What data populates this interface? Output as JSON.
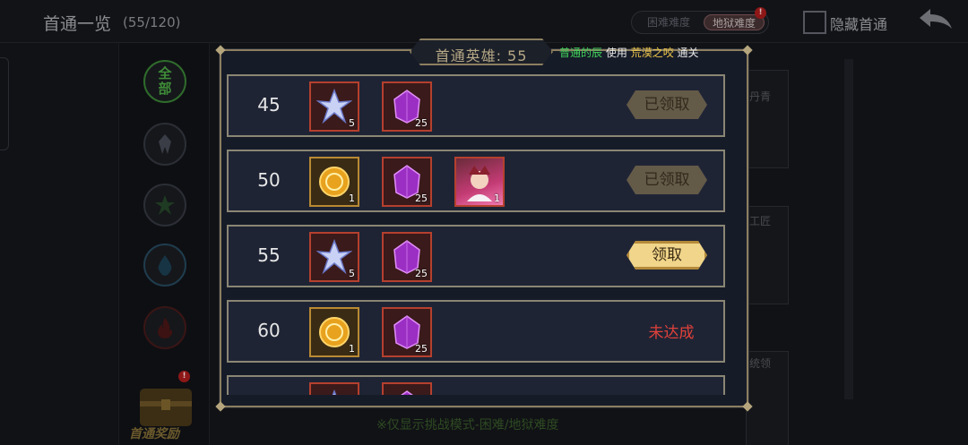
{
  "header": {
    "title": "首通一览",
    "count": "(55/120)",
    "difficulty_hard": "困难难度",
    "difficulty_hell": "地狱难度",
    "difficulty_badge": "!",
    "hide_label": "隐藏首通"
  },
  "sidebar": {
    "all_label_top": "全",
    "all_label_bottom": "部",
    "reward_tab_label": "首通奖励",
    "reward_badge": "!"
  },
  "background_cards": [
    "丹青",
    "工匠",
    "统领"
  ],
  "bottom_note": "※仅显示挑战模式-困难/地狱难度",
  "modal": {
    "title": "首通英雄: 55",
    "hero_name": "普通的辰",
    "use_word": "使用",
    "stage_name": "荒漠之咬",
    "clear_word": "通关",
    "rows": [
      {
        "level": "45",
        "rewards": [
          {
            "icon": "star-shard-icon",
            "count": "5"
          },
          {
            "icon": "purple-crystal-icon",
            "count": "25"
          }
        ],
        "status": "已领取"
      },
      {
        "level": "50",
        "rewards": [
          {
            "icon": "gold-medal-icon",
            "count": "1"
          },
          {
            "icon": "purple-crystal-icon",
            "count": "25"
          },
          {
            "icon": "hero-portrait-icon",
            "count": "1"
          }
        ],
        "status": "已领取"
      },
      {
        "level": "55",
        "rewards": [
          {
            "icon": "star-shard-icon",
            "count": "5"
          },
          {
            "icon": "purple-crystal-icon",
            "count": "25"
          }
        ],
        "status": "领取"
      },
      {
        "level": "60",
        "rewards": [
          {
            "icon": "gold-medal-icon",
            "count": "1"
          },
          {
            "icon": "purple-crystal-icon",
            "count": "25"
          }
        ],
        "status": "未达成"
      }
    ]
  },
  "colors": {
    "hero_name": "#42d35a",
    "stage_name": "#f0c84a",
    "not_done": "#e0413a",
    "frame_gold": "#8c7f60"
  }
}
